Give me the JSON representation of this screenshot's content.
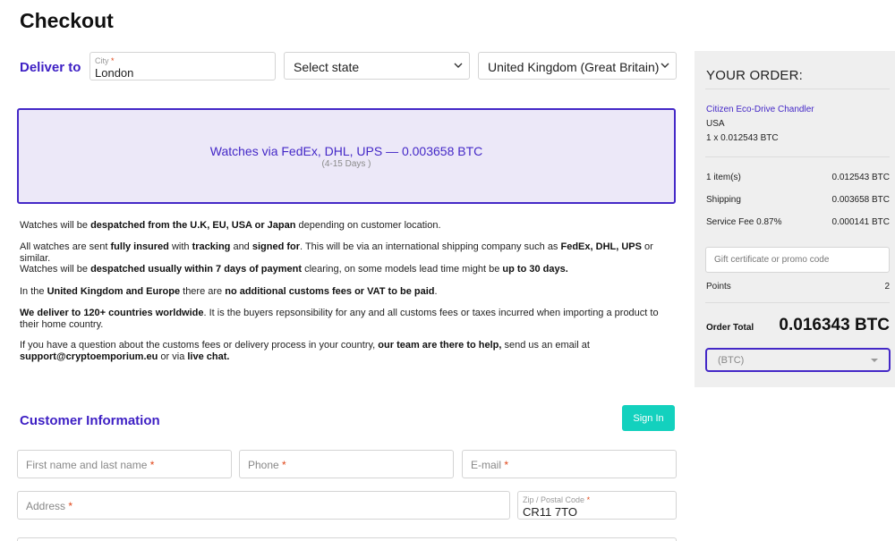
{
  "page": {
    "title": "Checkout"
  },
  "deliver": {
    "label": "Deliver to",
    "city": {
      "label": "City",
      "required_mark": "*",
      "value": "London"
    },
    "state": {
      "value": "Select state"
    },
    "country": {
      "value": "United Kingdom (Great Britain)"
    }
  },
  "shipping_option": {
    "title": "Watches via FedEx, DHL, UPS — 0.003658 BTC",
    "subtitle": "(4-15 Days )"
  },
  "info": {
    "p1": [
      "Watches will be ",
      "despatched from the U.K, EU, USA or Japan",
      " depending on customer location."
    ],
    "p2": [
      "All watches are sent ",
      "fully insured",
      " with ",
      "tracking",
      " and ",
      "signed for",
      ". This will be via an international shipping company such as ",
      "FedEx, DHL, UPS",
      " or similar."
    ],
    "p3": [
      "Watches will be ",
      "despatched usually within 7 days of payment",
      " clearing, on some models lead time might be ",
      "up to 30 days."
    ],
    "p4": [
      "In the ",
      "United Kingdom and Europe",
      " there are ",
      "no additional customs fees or VAT to be paid",
      "."
    ],
    "p5": [
      "We deliver to 120+ countries worldwide",
      ". It is the buyers repsonsibility for any and all customs fees or taxes incurred when importing a product to their home country."
    ],
    "p6": [
      "If you have a question about the customs fees or delivery process in your country, ",
      "our team are there to help,",
      " send us an email at ",
      "support@cryptoemporium.eu",
      " or via ",
      "live chat."
    ]
  },
  "customer": {
    "title": "Customer Information",
    "signin_label": "Sign In",
    "name_placeholder": "First name and last name",
    "phone_placeholder": "Phone",
    "email_placeholder": "E-mail",
    "address_placeholder": "Address",
    "zip": {
      "label": "Zip / Postal Code",
      "value": "CR11 7TO"
    },
    "required_mark": "*"
  },
  "order": {
    "heading": "YOUR ORDER:",
    "product": {
      "name": "Citizen Eco-Drive Chandler",
      "origin": "USA",
      "qty": "1 x 0.012543 BTC"
    },
    "rows": [
      {
        "label": "1 item(s)",
        "value": "0.012543 BTC"
      },
      {
        "label": "Shipping",
        "value": "0.003658 BTC"
      },
      {
        "label": "Service Fee 0.87%",
        "value": "0.000141 BTC"
      }
    ],
    "promo_placeholder": "Gift certificate or promo code",
    "points": {
      "label": "Points",
      "value": "2"
    },
    "total": {
      "label": "Order Total",
      "value": "0.016343 BTC"
    },
    "currency": "(BTC)"
  },
  "colors": {
    "accent": "#4428c7",
    "heading_accent": "#3d1fc4",
    "button": "#13d1be",
    "sidebar_bg": "#efefef"
  }
}
